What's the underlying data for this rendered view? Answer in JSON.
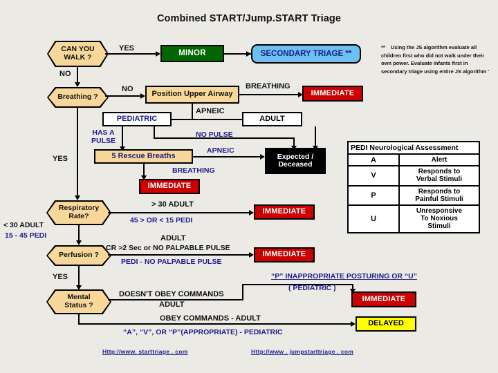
{
  "title": "Combined START/Jump.START Triage",
  "nodes": {
    "can_you_walk": "CAN YOU\nWALK ?",
    "breathing_q": "Breathing  ?",
    "respiratory_rate": "Respiratory\nRate?",
    "perfusion": "Perfusion ?",
    "mental_status": "Mental\nStatus ?",
    "minor": "MINOR",
    "secondary_triage": "SECONDARY TRIAGE  **",
    "position_upper_airway": "Position Upper Airway",
    "immediate_1": "IMMEDIATE",
    "pediatric": "PEDIATRIC",
    "adult": "ADULT",
    "five_rescue_breaths": "5 Rescue Breaths",
    "expected_deceased": "Expected /\nDeceased",
    "immediate_2": "IMMEDIATE",
    "immediate_3": "IMMEDIATE",
    "immediate_4": "IMMEDIATE",
    "immediate_5": "IMMEDIATE",
    "delayed": "DELAYED"
  },
  "edge_labels": {
    "yes_walk": "YES",
    "no_walk": "NO",
    "no_breathing": "NO",
    "breathing_after_airway": "BREATHING",
    "apneic_airway": "APNEIC",
    "has_a_pulse": "HAS A\nPULSE",
    "no_pulse": "NO PULSE",
    "apneic_breaths": "APNEIC",
    "breathing_breaths": "BREATHING",
    "yes_breathing": "YES",
    "rr_high_adult": ">  30  ADULT",
    "rr_high_pedi": "45 > OR < 15     PEDI",
    "rr_low_adult": "< 30 ADULT",
    "rr_low_pedi": "15 - 45 PEDI",
    "perf_adult_top": "ADULT",
    "perf_adult": "CR >2 Sec or NO PALPABLE PULSE",
    "perf_pedi": "PEDI - NO PALPABLE PULSE",
    "yes_perfusion": "YES",
    "ms_doesnt_obey": "DOESN'T OBEY COMMANDS",
    "ms_adult_1": "ADULT",
    "ms_p_inappropriate": "“P” INAPPROPRIATE POSTURING OR “U”",
    "ms_pediatric_paren": "( PEDIATRIC )",
    "ms_obey": "OBEY COMMANDS  -  ADULT",
    "ms_avp": "“A”, “V”, OR “P”(APPROPRIATE)  -  PEDIATRIC"
  },
  "footnote": {
    "marker": "**",
    "text": "Using the JS algorithm evaluate  all children first who did not walk  under their own power. Evaluate  infants first in secondary triage using entire JS algorithm '"
  },
  "pedi_table": {
    "header": "PEDI Neurological Assessment",
    "rows": [
      {
        "code": "A",
        "meaning": "Alert"
      },
      {
        "code": "V",
        "meaning": "Responds to\nVerbal Stimuli"
      },
      {
        "code": "P",
        "meaning": "Responds to\nPainful Stimuli"
      },
      {
        "code": "U",
        "meaning": "Unresponsive\nTo Noxious\nStimuli"
      }
    ]
  },
  "links": {
    "start": "Http://www. starttriage . com",
    "jumpstart": "Http://www . jumpstarttriage . com"
  },
  "colors": {
    "background": "#eceae5",
    "hex_fill": "#f7d89a",
    "minor_green": "#006600",
    "secondary_blue": "#6cc0f0",
    "immediate_red": "#cc0000",
    "delayed_yellow": "#ffff00",
    "expected_black": "#000000",
    "label_blue": "#1c1c8c"
  }
}
